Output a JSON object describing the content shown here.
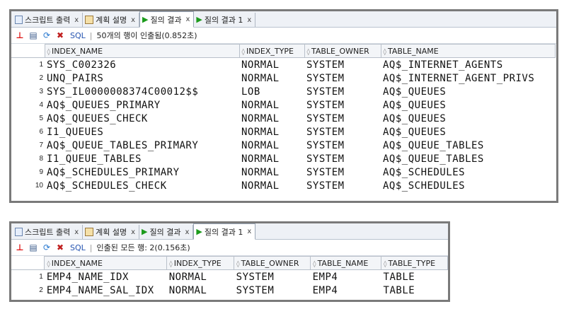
{
  "panel1": {
    "tabs": [
      {
        "label": "스크립트 출력",
        "close": "x",
        "icon": "script-output-icon"
      },
      {
        "label": "계획 설명",
        "close": "x",
        "icon": "explain-plan-icon"
      },
      {
        "label": "질의 결과",
        "close": "x",
        "icon": "query-result-icon"
      },
      {
        "label": "질의 결과 1",
        "close": "x",
        "icon": "query-result-icon"
      }
    ],
    "active_tab": 2,
    "toolbar": {
      "sql_label": "SQL",
      "separator": "|",
      "status": "50개의 행이 인출됨(0.852초)"
    },
    "columns": [
      "INDEX_NAME",
      "INDEX_TYPE",
      "TABLE_OWNER",
      "TABLE_NAME"
    ],
    "rows": [
      [
        "1",
        "SYS_C002326",
        "NORMAL",
        "SYSTEM",
        "AQ$_INTERNET_AGENTS"
      ],
      [
        "2",
        "UNQ_PAIRS",
        "NORMAL",
        "SYSTEM",
        "AQ$_INTERNET_AGENT_PRIVS"
      ],
      [
        "3",
        "SYS_IL0000008374C00012$$",
        "LOB",
        "SYSTEM",
        "AQ$_QUEUES"
      ],
      [
        "4",
        "AQ$_QUEUES_PRIMARY",
        "NORMAL",
        "SYSTEM",
        "AQ$_QUEUES"
      ],
      [
        "5",
        "AQ$_QUEUES_CHECK",
        "NORMAL",
        "SYSTEM",
        "AQ$_QUEUES"
      ],
      [
        "6",
        "I1_QUEUES",
        "NORMAL",
        "SYSTEM",
        "AQ$_QUEUES"
      ],
      [
        "7",
        "AQ$_QUEUE_TABLES_PRIMARY",
        "NORMAL",
        "SYSTEM",
        "AQ$_QUEUE_TABLES"
      ],
      [
        "8",
        "I1_QUEUE_TABLES",
        "NORMAL",
        "SYSTEM",
        "AQ$_QUEUE_TABLES"
      ],
      [
        "9",
        "AQ$_SCHEDULES_PRIMARY",
        "NORMAL",
        "SYSTEM",
        "AQ$_SCHEDULES"
      ],
      [
        "10",
        "AQ$_SCHEDULES_CHECK",
        "NORMAL",
        "SYSTEM",
        "AQ$_SCHEDULES"
      ]
    ]
  },
  "panel2": {
    "tabs": [
      {
        "label": "스크립트 출력",
        "close": "x",
        "icon": "script-output-icon"
      },
      {
        "label": "계획 설명",
        "close": "x",
        "icon": "explain-plan-icon"
      },
      {
        "label": "질의 결과",
        "close": "x",
        "icon": "query-result-icon"
      },
      {
        "label": "질의 결과 1",
        "close": "x",
        "icon": "query-result-icon"
      }
    ],
    "active_tab": 3,
    "toolbar": {
      "sql_label": "SQL",
      "separator": "|",
      "status": "인출된 모든 행: 2(0.156초)"
    },
    "columns": [
      "INDEX_NAME",
      "INDEX_TYPE",
      "TABLE_OWNER",
      "TABLE_NAME",
      "TABLE_TYPE"
    ],
    "rows": [
      [
        "1",
        "EMP4_NAME_IDX",
        "NORMAL",
        "SYSTEM",
        "EMP4",
        "TABLE"
      ],
      [
        "2",
        "EMP4_NAME_SAL_IDX",
        "NORMAL",
        "SYSTEM",
        "EMP4",
        "TABLE"
      ]
    ]
  },
  "icons": {
    "pin": "pin-icon",
    "print": "print-icon",
    "refresh": "refresh-icon",
    "cancel": "cancel-icon",
    "sort": "sort-icon"
  },
  "colors": {
    "frame": "#7a7a7a",
    "play_green": "#1c9b1c",
    "pin_red": "#dd1111"
  }
}
